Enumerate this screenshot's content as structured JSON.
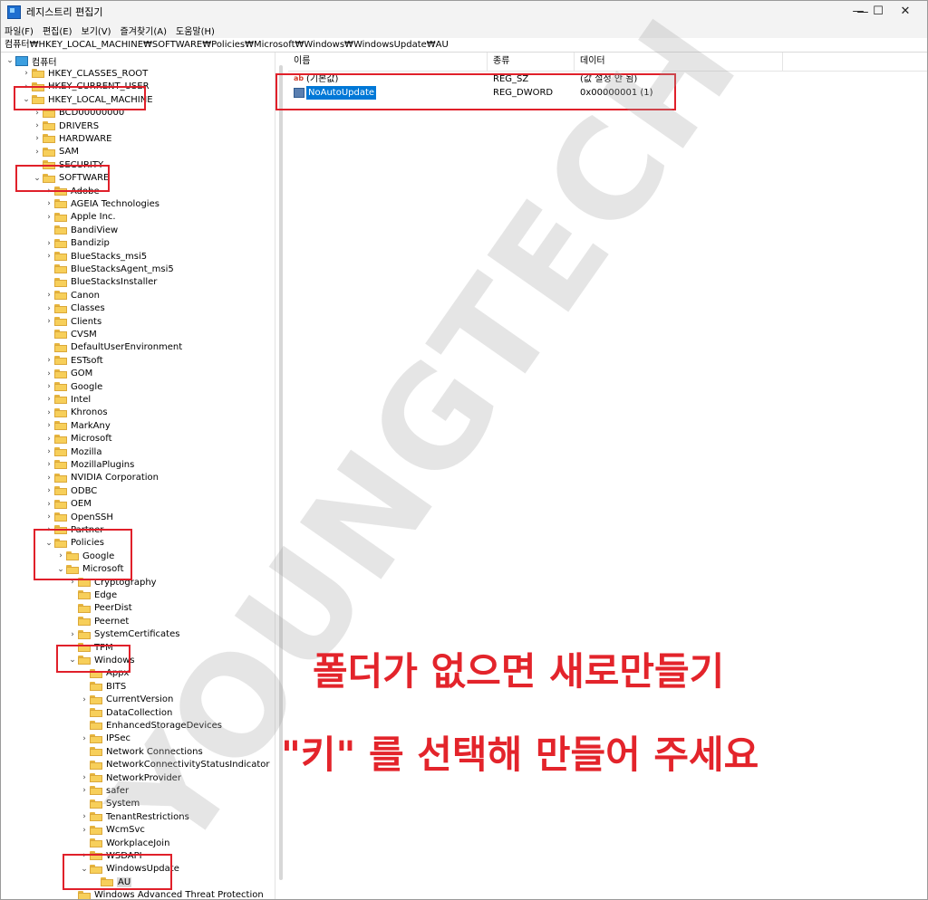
{
  "window": {
    "title": "레지스트리 편집기",
    "controls": [
      "—",
      "☐",
      "✕"
    ]
  },
  "menu": [
    "파일(F)",
    "편집(E)",
    "보기(V)",
    "즐겨찾기(A)",
    "도움말(H)"
  ],
  "address": "컴퓨터₩HKEY_LOCAL_MACHINE₩SOFTWARE₩Policies₩Microsoft₩Windows₩WindowsUpdate₩AU",
  "tree": {
    "root": "컴퓨터",
    "items": [
      {
        "label": "HKEY_CLASSES_ROOT",
        "level": 1,
        "expander": ">"
      },
      {
        "label": "HKEY_CURRENT_USER",
        "level": 1,
        "expander": ">"
      },
      {
        "label": "HKEY_LOCAL_MACHINE",
        "level": 1,
        "expander": "v"
      },
      {
        "label": "BCD00000000",
        "level": 2,
        "expander": ">"
      },
      {
        "label": "DRIVERS",
        "level": 2,
        "expander": ">"
      },
      {
        "label": "HARDWARE",
        "level": 2,
        "expander": ">"
      },
      {
        "label": "SAM",
        "level": 2,
        "expander": ">"
      },
      {
        "label": "SECURITY",
        "level": 2,
        "expander": ""
      },
      {
        "label": "SOFTWARE",
        "level": 2,
        "expander": "v"
      },
      {
        "label": "Adobe",
        "level": 3,
        "expander": ">"
      },
      {
        "label": "AGEIA Technologies",
        "level": 3,
        "expander": ">"
      },
      {
        "label": "Apple Inc.",
        "level": 3,
        "expander": ">"
      },
      {
        "label": "BandiView",
        "level": 3,
        "expander": ""
      },
      {
        "label": "Bandizip",
        "level": 3,
        "expander": ">"
      },
      {
        "label": "BlueStacks_msi5",
        "level": 3,
        "expander": ">"
      },
      {
        "label": "BlueStacksAgent_msi5",
        "level": 3,
        "expander": ""
      },
      {
        "label": "BlueStacksInstaller",
        "level": 3,
        "expander": ""
      },
      {
        "label": "Canon",
        "level": 3,
        "expander": ">"
      },
      {
        "label": "Classes",
        "level": 3,
        "expander": ">"
      },
      {
        "label": "Clients",
        "level": 3,
        "expander": ">"
      },
      {
        "label": "CVSM",
        "level": 3,
        "expander": ""
      },
      {
        "label": "DefaultUserEnvironment",
        "level": 3,
        "expander": ""
      },
      {
        "label": "ESTsoft",
        "level": 3,
        "expander": ">"
      },
      {
        "label": "GOM",
        "level": 3,
        "expander": ">"
      },
      {
        "label": "Google",
        "level": 3,
        "expander": ">"
      },
      {
        "label": "Intel",
        "level": 3,
        "expander": ">"
      },
      {
        "label": "Khronos",
        "level": 3,
        "expander": ">"
      },
      {
        "label": "MarkAny",
        "level": 3,
        "expander": ">"
      },
      {
        "label": "Microsoft",
        "level": 3,
        "expander": ">"
      },
      {
        "label": "Mozilla",
        "level": 3,
        "expander": ">"
      },
      {
        "label": "MozillaPlugins",
        "level": 3,
        "expander": ">"
      },
      {
        "label": "NVIDIA Corporation",
        "level": 3,
        "expander": ">"
      },
      {
        "label": "ODBC",
        "level": 3,
        "expander": ">"
      },
      {
        "label": "OEM",
        "level": 3,
        "expander": ">"
      },
      {
        "label": "OpenSSH",
        "level": 3,
        "expander": ">"
      },
      {
        "label": "Partner",
        "level": 3,
        "expander": ">"
      },
      {
        "label": "Policies",
        "level": 3,
        "expander": "v"
      },
      {
        "label": "Google",
        "level": 4,
        "expander": ">"
      },
      {
        "label": "Microsoft",
        "level": 4,
        "expander": "v"
      },
      {
        "label": "Cryptography",
        "level": 5,
        "expander": ">"
      },
      {
        "label": "Edge",
        "level": 5,
        "expander": ""
      },
      {
        "label": "PeerDist",
        "level": 5,
        "expander": ""
      },
      {
        "label": "Peernet",
        "level": 5,
        "expander": ""
      },
      {
        "label": "SystemCertificates",
        "level": 5,
        "expander": ">"
      },
      {
        "label": "TPM",
        "level": 5,
        "expander": ""
      },
      {
        "label": "Windows",
        "level": 5,
        "expander": "v"
      },
      {
        "label": "Appx",
        "level": 6,
        "expander": ""
      },
      {
        "label": "BITS",
        "level": 6,
        "expander": ""
      },
      {
        "label": "CurrentVersion",
        "level": 6,
        "expander": ">"
      },
      {
        "label": "DataCollection",
        "level": 6,
        "expander": ""
      },
      {
        "label": "EnhancedStorageDevices",
        "level": 6,
        "expander": ""
      },
      {
        "label": "IPSec",
        "level": 6,
        "expander": ">"
      },
      {
        "label": "Network Connections",
        "level": 6,
        "expander": ""
      },
      {
        "label": "NetworkConnectivityStatusIndicator",
        "level": 6,
        "expander": ""
      },
      {
        "label": "NetworkProvider",
        "level": 6,
        "expander": ">"
      },
      {
        "label": "safer",
        "level": 6,
        "expander": ">"
      },
      {
        "label": "System",
        "level": 6,
        "expander": ""
      },
      {
        "label": "TenantRestrictions",
        "level": 6,
        "expander": ">"
      },
      {
        "label": "WcmSvc",
        "level": 6,
        "expander": ">"
      },
      {
        "label": "WorkplaceJoin",
        "level": 6,
        "expander": ""
      },
      {
        "label": "WSDAPI",
        "level": 6,
        "expander": ">"
      },
      {
        "label": "WindowsUpdate",
        "level": 6,
        "expander": "v"
      },
      {
        "label": "AU",
        "level": 7,
        "expander": "",
        "selected": true
      },
      {
        "label": "Windows Advanced Threat Protection",
        "level": 5,
        "expander": ""
      }
    ]
  },
  "list": {
    "headers": {
      "name": "이름",
      "type": "종류",
      "data": "데이터"
    },
    "rows": [
      {
        "icon": "string-value-icon",
        "name": "(기본값)",
        "type": "REG_SZ",
        "data": "(값 설정 안 됨)"
      },
      {
        "icon": "dword-value-icon",
        "name": "NoAutoUpdate",
        "type": "REG_DWORD",
        "data": "0x00000001 (1)",
        "selected": true
      }
    ]
  },
  "overlay": {
    "watermark": "YOUNGTECH",
    "line1": "폴더가 없으면 새로만들기",
    "line2": "\"키\" 를 선택해 만들어 주세요",
    "highlight_color": "#e0202a",
    "text_color": "#e3242b"
  }
}
